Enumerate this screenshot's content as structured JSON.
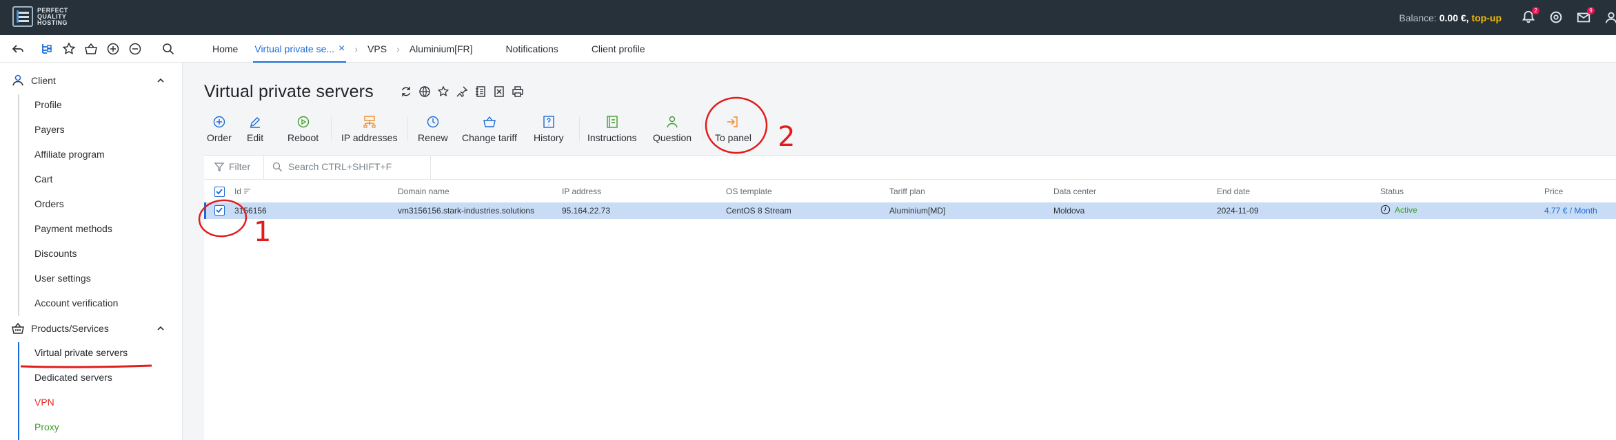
{
  "header": {
    "logo_text": "PERFECT QUALITY HOSTING",
    "balance_label": "Balance:",
    "balance_value": "0.00 €,",
    "topup_label": "top-up",
    "notifications_count": "2",
    "messages_count": "9"
  },
  "tabs": [
    {
      "label": "Home"
    },
    {
      "label": "Virtual private se..."
    },
    {
      "label": "VPS"
    },
    {
      "label": "Aluminium[FR]"
    },
    {
      "label": "Notifications"
    },
    {
      "label": "Client profile"
    }
  ],
  "tab_close": "×",
  "tab_sep": "›",
  "sidebar": {
    "client_group": "Client",
    "client_items": [
      "Profile",
      "Payers",
      "Affiliate program",
      "Cart",
      "Orders",
      "Payment methods",
      "Discounts",
      "User settings",
      "Account verification"
    ],
    "products_group": "Products/Services",
    "products_items": [
      "Virtual private servers",
      "Dedicated servers",
      "VPN",
      "Proxy"
    ]
  },
  "page": {
    "title": "Virtual private servers"
  },
  "toolbar": {
    "order": "Order",
    "edit": "Edit",
    "reboot": "Reboot",
    "ip_addresses": "IP addresses",
    "renew": "Renew",
    "change_tariff": "Change tariff",
    "history": "History",
    "instructions": "Instructions",
    "question": "Question",
    "to_panel": "To panel"
  },
  "filter": {
    "filter_label": "Filter",
    "search_placeholder": "Search CTRL+SHIFT+F"
  },
  "table": {
    "columns": [
      "Id",
      "Domain name",
      "IP address",
      "OS template",
      "Tariff plan",
      "Data center",
      "End date",
      "Status",
      "Price"
    ],
    "rows": [
      {
        "id": "3156156",
        "domain": "vm3156156.stark-industries.solutions",
        "ip": "95.164.22.73",
        "os": "CentOS 8 Stream",
        "tariff": "Aluminium[MD]",
        "datacenter": "Moldova",
        "end_date": "2024-11-09",
        "status": "Active",
        "price": "4.77 € / Month"
      }
    ]
  },
  "annotations": {
    "one": "1",
    "two": "2"
  },
  "colors": {
    "accent": "#1b6bd6",
    "header_bg": "#27313a",
    "topup": "#f1b80a",
    "annotation": "#e01d1d",
    "status_active": "#3f9c2b"
  }
}
